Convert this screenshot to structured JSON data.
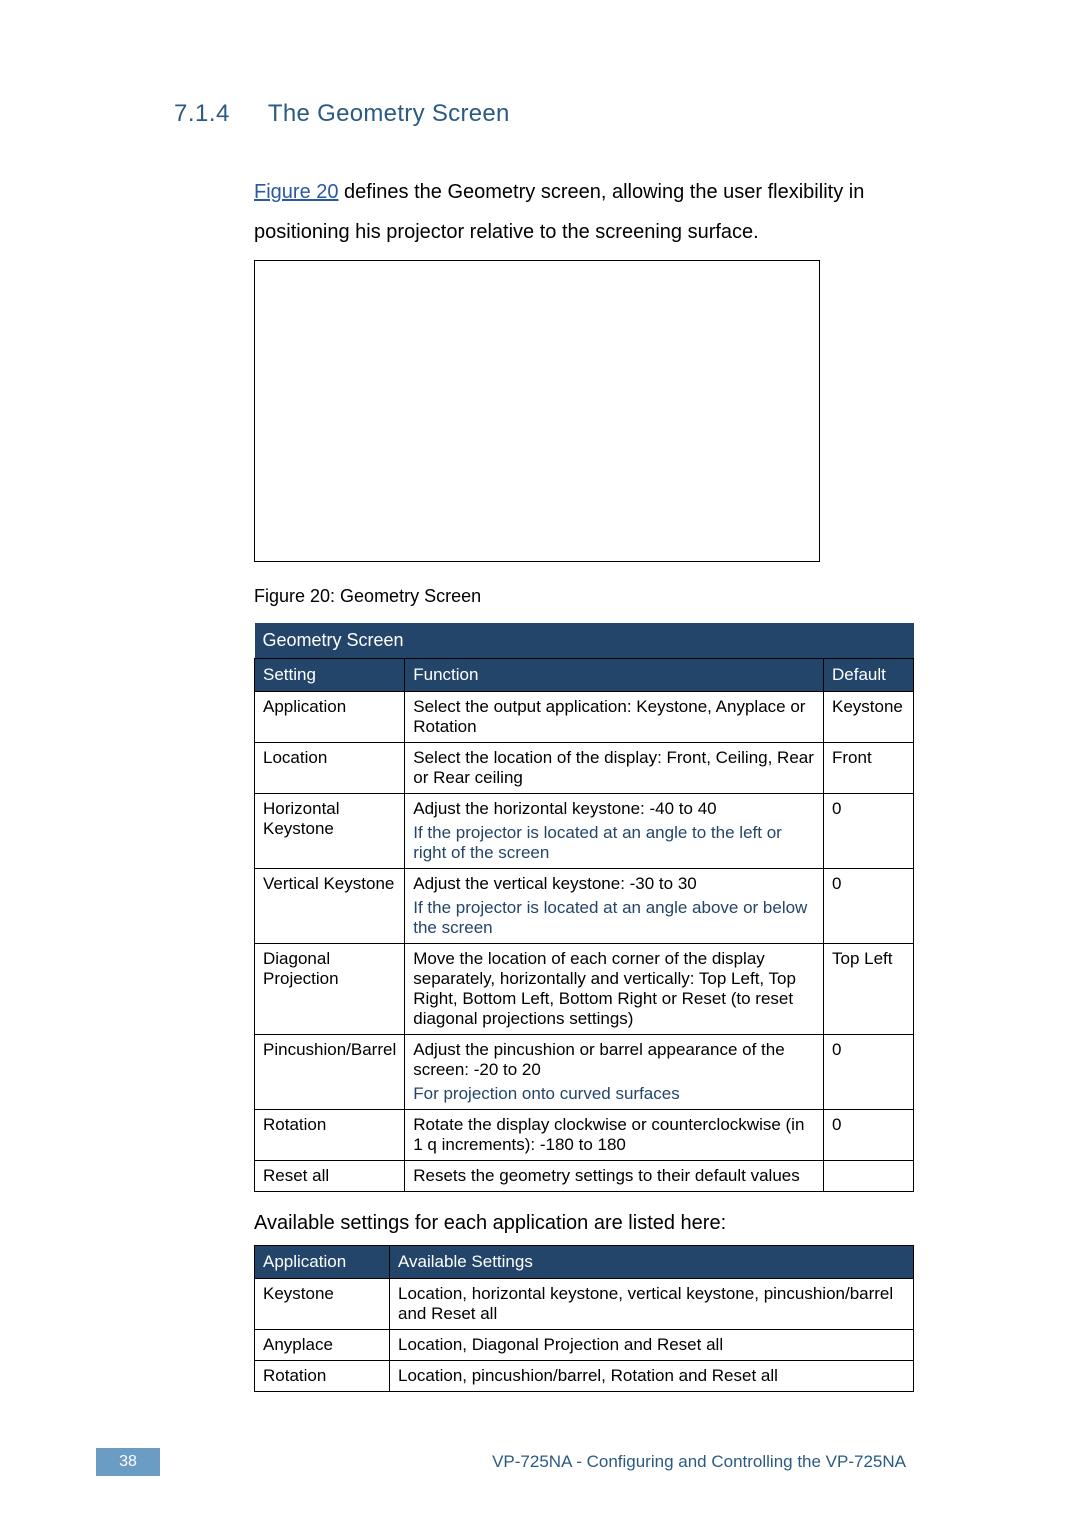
{
  "heading": {
    "num": "7.1.4",
    "title": "The Geometry Screen"
  },
  "intro": {
    "link": "Figure 20",
    "after_link": " defines the Geometry screen, allowing the user flexibility in positioning his projector relative to the screening surface."
  },
  "caption": "Figure 20: Geometry Screen",
  "table1": {
    "title": "Geometry Screen",
    "headers": {
      "setting": "Setting",
      "func": "Function",
      "def": "Default"
    },
    "rows": [
      {
        "setting": "Application",
        "func": "Select the output application: Keystone, Anyplace or Rotation",
        "note": "",
        "def": "Keystone"
      },
      {
        "setting": "Location",
        "func": "Select the location of the display: Front, Ceiling, Rear or Rear ceiling",
        "note": "",
        "def": "Front"
      },
      {
        "setting": "Horizontal Keystone",
        "func": "Adjust the horizontal keystone: -40 to 40",
        "note": "If the projector is located at an angle to the left or right of the screen",
        "def": "0"
      },
      {
        "setting": "Vertical Keystone",
        "func": "Adjust the vertical keystone: -30 to 30",
        "note": "If the projector is located at an angle above or below the screen",
        "def": "0"
      },
      {
        "setting": "Diagonal Projection",
        "func": "Move the location of each corner of the display separately, horizontally and vertically: Top Left, Top Right, Bottom Left, Bottom Right or Reset (to reset diagonal projections settings)",
        "note": "",
        "def": "Top Left"
      },
      {
        "setting": "Pincushion/Barrel",
        "func": "Adjust the pincushion or barrel appearance of the screen: -20 to 20",
        "note": "For projection onto curved surfaces",
        "def": "0"
      },
      {
        "setting": "Rotation",
        "func": "Rotate the display clockwise or counterclockwise (in 1 q increments): -180 to 180",
        "note": "",
        "def": "0"
      },
      {
        "setting": "Reset all",
        "func": "Resets the geometry settings to their default values",
        "note": "",
        "def": ""
      }
    ]
  },
  "avail_intro": "Available settings for each application are listed here:",
  "table2": {
    "headers": {
      "app": "Application",
      "avail": "Available Settings"
    },
    "rows": [
      {
        "app": "Keystone",
        "avail": "Location, horizontal keystone, vertical keystone, pincushion/barrel and Reset all"
      },
      {
        "app": "Anyplace",
        "avail": "Location, Diagonal Projection and Reset all"
      },
      {
        "app": "Rotation",
        "avail": "Location, pincushion/barrel, Rotation and Reset all"
      }
    ]
  },
  "footer": {
    "page": "38",
    "title": "VP-725NA - Configuring and Controlling the VP-725NA"
  }
}
